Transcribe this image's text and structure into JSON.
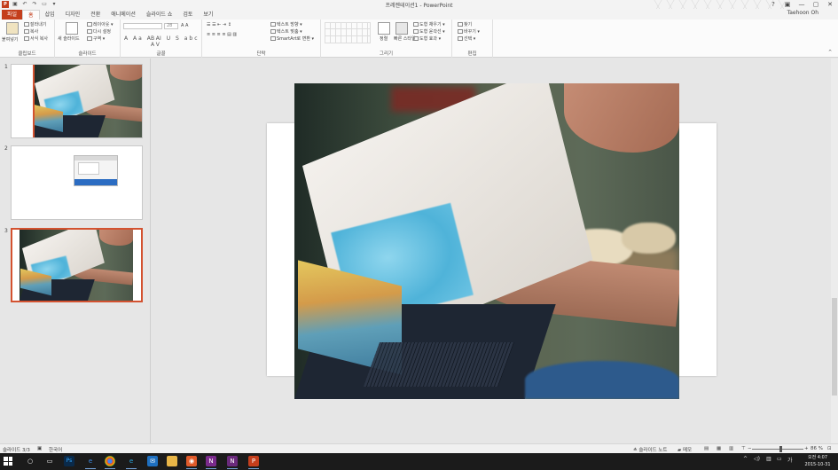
{
  "window": {
    "title": "프레젠테이션1 - PowerPoint",
    "app_logo": "P",
    "user": "Taehoon Oh",
    "controls": [
      "?",
      "▣",
      "—",
      "▢",
      "✕"
    ]
  },
  "qat": [
    "save-icon",
    "undo-icon",
    "redo-icon",
    "start-icon",
    "customize-icon"
  ],
  "tabs": [
    {
      "label": "파일",
      "kind": "file"
    },
    {
      "label": "홈",
      "kind": "active"
    },
    {
      "label": "삽입"
    },
    {
      "label": "디자인"
    },
    {
      "label": "전환"
    },
    {
      "label": "애니메이션"
    },
    {
      "label": "슬라이드 쇼"
    },
    {
      "label": "검토"
    },
    {
      "label": "보기"
    }
  ],
  "ribbon": {
    "clipboard": {
      "label": "클립보드",
      "paste": "붙여넣기",
      "cut": "잘라내기",
      "copy": "복사",
      "format_painter": "서식 복사"
    },
    "slides": {
      "label": "슬라이드",
      "new_slide": "새 슬라이드",
      "layout": "레이아웃",
      "reset": "다시 설정",
      "section": "구역"
    },
    "font": {
      "label": "글꼴",
      "font_name": "",
      "font_size": "28",
      "format_row1": "B I U S abc AV",
      "format_row2": "A Aa A A"
    },
    "paragraph": {
      "label": "단락",
      "text_direction": "텍스트 방향",
      "align_text": "텍스트 맞춤",
      "smartart": "SmartArt로 변환"
    },
    "drawing": {
      "label": "그리기",
      "arrange": "정렬",
      "quick_styles": "빠른 스타일",
      "shape_fill": "도형 채우기",
      "shape_outline": "도형 윤곽선",
      "shape_effects": "도형 효과"
    },
    "editing": {
      "label": "편집",
      "find": "찾기",
      "replace": "바꾸기",
      "select": "선택"
    }
  },
  "thumbnails": [
    {
      "number": "1",
      "selected": false
    },
    {
      "number": "2",
      "selected": false
    },
    {
      "number": "3",
      "selected": true
    }
  ],
  "statusbar": {
    "slide_count": "슬라이드 3/3",
    "language": "한국어",
    "notes": "슬라이드 노트",
    "comments": "메모",
    "zoom": "86 %",
    "zoom_fraction": 0.55
  },
  "taskbar": {
    "icons": [
      "start-icon",
      "search-icon",
      "task-view-icon",
      "photoshop-icon",
      "edge-icon",
      "chrome-icon",
      "ie-icon",
      "mail-icon",
      "explorer-icon",
      "app-icon",
      "onenote-icon",
      "onenote2-icon",
      "powerpoint-icon"
    ],
    "ps_label": "Ps",
    "ime": "가",
    "time": "오전 4:07",
    "date": "2015-10-31"
  }
}
